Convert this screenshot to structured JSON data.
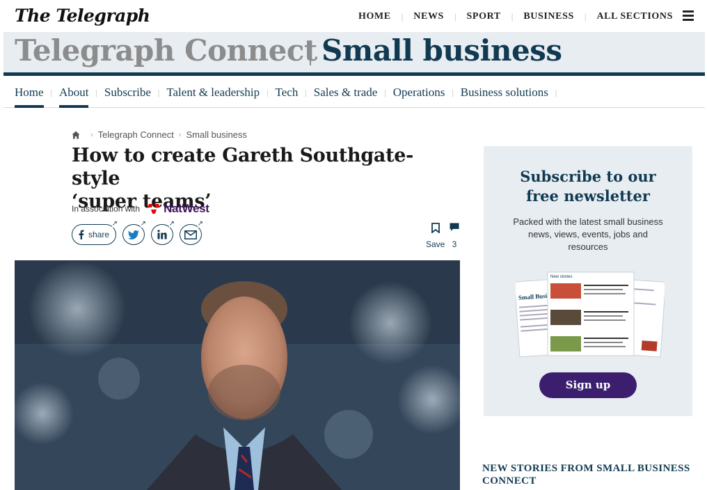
{
  "site": {
    "logo": "The Telegraph"
  },
  "topnav": {
    "items": [
      "HOME",
      "NEWS",
      "SPORT",
      "BUSINESS",
      "ALL SECTIONS"
    ]
  },
  "banner": {
    "brand": "Telegraph Connect",
    "section": "Small business"
  },
  "secnav": {
    "items": [
      "Home",
      "About",
      "Subscribe",
      "Talent & leadership",
      "Tech",
      "Sales & trade",
      "Operations",
      "Business solutions"
    ]
  },
  "breadcrumb": {
    "items": [
      "Telegraph Connect",
      "Small business"
    ]
  },
  "article": {
    "headline_line1": "How to create Gareth Southgate-style",
    "headline_line2": "‘super teams’",
    "association_text": "In association with",
    "sponsor": "NatWest",
    "share_label": "share",
    "save_label": "Save",
    "comment_count": "3"
  },
  "ad": {
    "heading_line1": "Subscribe to our",
    "heading_line2": "free newsletter",
    "body": "Packed with the latest small business news, views, events, jobs and resources",
    "preview_header": "New stories",
    "preview_title": "Small Busi",
    "signup_label": "Sign up"
  },
  "sidebar": {
    "new_stories_heading": "NEW STORIES FROM SMALL BUSINESS CONNECT"
  },
  "colors": {
    "navy": "#113a52",
    "banner_bg": "#e8edf1",
    "natwest_purple": "#42145f",
    "natwest_red": "#e10a0a",
    "signup_bg": "#3b1f6e"
  }
}
